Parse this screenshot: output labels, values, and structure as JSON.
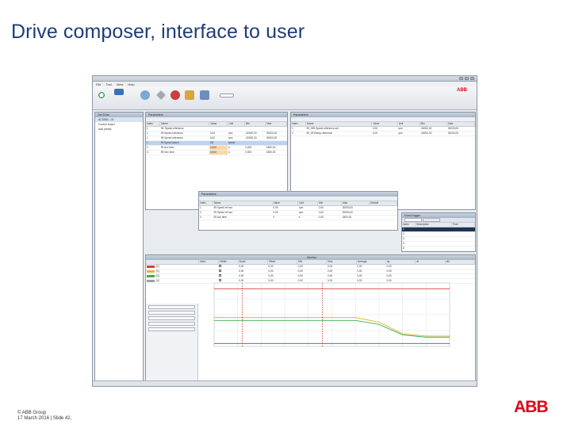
{
  "slide": {
    "title": "Drive composer, interface to user",
    "footer_line1": "© ABB Group",
    "footer_line2": "17 March 2016 | Slide 42,",
    "logo": "ABB"
  },
  "colors": {
    "brand_red": "#e10019",
    "title_blue": "#1f3c78",
    "selection_blue": "#bcd3ee",
    "highlight_orange": "#fbd7a1"
  },
  "app": {
    "menu": [
      "File",
      "Tool",
      "View",
      "Help"
    ],
    "ribbon_logo": "ABB",
    "ribbon_buttons": [
      "",
      "",
      "",
      "",
      "",
      ""
    ]
  },
  "drive_list": {
    "header": "Get Drive",
    "items": [
      "ACS880 - 02",
      "Control board",
      "Add preset"
    ]
  },
  "params_left": {
    "header": "Parameters",
    "columns": [
      "Index",
      "Name",
      "Value",
      "Unit",
      "Min",
      "Max"
    ],
    "rows": [
      {
        "index": "1",
        "name": "99. Speed reference",
        "value": "",
        "unit": "",
        "min": "",
        "max": "",
        "sel": false
      },
      {
        "index": "1",
        "name": "99 Speed reference",
        "value": "0.00",
        "unit": "rpm",
        "min": "-30000,00",
        "max": "30000,00",
        "sel": false
      },
      {
        "index": "1",
        "name": "99 Speed reference",
        "value": "0.00",
        "unit": "rpm",
        "min": "-30000,00",
        "max": "30000,00",
        "sel": false
      },
      {
        "index": "1",
        "name": "99 Speed select",
        "value": "Off",
        "unit": "select",
        "min": "",
        "max": "",
        "sel": true
      },
      {
        "index": "2",
        "name": "99 Acc time",
        "value": "2,000",
        "unit": "s",
        "min": "0,000",
        "max": "1800,00",
        "sel": false
      },
      {
        "index": "3",
        "name": "99 Dec time",
        "value": "2,000",
        "unit": "s",
        "min": "0,000",
        "max": "1800,00",
        "sel": false
      }
    ]
  },
  "params_right": {
    "header": "Parameters",
    "columns": [
      "Index",
      "Name",
      "Value",
      "Unit",
      "Min",
      "Max"
    ],
    "rows": [
      {
        "index": "1",
        "name": "99_999 Speed reference act",
        "value": "0.00",
        "unit": "rpm",
        "min": "-30000,00",
        "max": "30000,00"
      },
      {
        "index": "2",
        "name": "99_99 Ramp reference",
        "value": "0.00",
        "unit": "rpm",
        "min": "-30000,00",
        "max": "30000,00"
      }
    ]
  },
  "params_mid": {
    "header": "Parameters",
    "columns": [
      "Index",
      "Name",
      "Value",
      "Unit",
      "Min",
      "Max",
      "Default"
    ],
    "rows": [
      {
        "index": "1",
        "name": "99 Speed ref act",
        "value": "0.00",
        "unit": "rpm",
        "min": "0,00",
        "max": "30000,00",
        "def": ""
      },
      {
        "index": "2",
        "name": "99 Speed ref act",
        "value": "0.00",
        "unit": "rpm",
        "min": "0,00",
        "max": "30000,00",
        "def": ""
      },
      {
        "index": "3",
        "name": "99 Acc time",
        "value": "0",
        "unit": "s",
        "min": "0,00",
        "max": "1800,00",
        "def": ""
      }
    ]
  },
  "fault_logger": {
    "header": "Event logger",
    "tabs": [
      "",
      ""
    ],
    "columns": [
      "Index",
      "Description",
      "Time"
    ],
    "rows": [
      {
        "index": "1",
        "desc": "",
        "time": "",
        "dark": true
      },
      {
        "index": "2",
        "desc": "",
        "time": "",
        "dark": false
      },
      {
        "index": "3",
        "desc": "",
        "time": "",
        "dark": false
      },
      {
        "index": "4",
        "desc": "",
        "time": "",
        "dark": false
      },
      {
        "index": "5",
        "desc": "",
        "time": "",
        "dark": false
      }
    ]
  },
  "monitor": {
    "header": "Monitor",
    "columns": [
      "",
      "Index",
      "Visible",
      "Scale",
      "Offset",
      "Min",
      "Max",
      "Average",
      "dy",
      "dt",
      "dt2"
    ],
    "rows": [
      {
        "name": "[1]",
        "color": "#d23d3d",
        "vals": [
          "0,00",
          "0,00",
          "0,00",
          "0,00",
          "0,00",
          "0,00",
          "",
          ""
        ]
      },
      {
        "name": "[2]",
        "color": "#d9b830",
        "vals": [
          "0,00",
          "0,00",
          "0,00",
          "0,00",
          "0,00",
          "0,00",
          "",
          ""
        ]
      },
      {
        "name": "[3]",
        "color": "#3fae49",
        "vals": [
          "0,00",
          "0,00",
          "0,00",
          "0,00",
          "0,00",
          "0,00",
          "",
          ""
        ]
      },
      {
        "name": "[4]",
        "color": "#9aa0a6",
        "vals": [
          "0,00",
          "0,00",
          "0,00",
          "0,00",
          "0,00",
          "0,00",
          "",
          ""
        ]
      }
    ],
    "side_labels": [
      "",
      "",
      "",
      "",
      ""
    ]
  },
  "chart_data": {
    "type": "line",
    "x": [
      0,
      1,
      2,
      3,
      4,
      5,
      6,
      7,
      8,
      9,
      10
    ],
    "series": [
      {
        "values": [
          1,
          1,
          1,
          1,
          1,
          1,
          1,
          1,
          1,
          1,
          1
        ],
        "color": "#d23d3d"
      },
      {
        "values": [
          0.5,
          0.5,
          0.5,
          0.5,
          0.5,
          0.5,
          0.5,
          0.42,
          0.22,
          0.18,
          0.18
        ],
        "color": "#d9b830"
      },
      {
        "values": [
          0.45,
          0.45,
          0.45,
          0.45,
          0.45,
          0.45,
          0.45,
          0.38,
          0.2,
          0.16,
          0.16
        ],
        "color": "#3fae49"
      },
      {
        "values": [
          0.05,
          0.05,
          0.05,
          0.05,
          0.05,
          0.05,
          0.05,
          0.05,
          0.05,
          0.05,
          0.05
        ],
        "color": "#6d7278"
      }
    ],
    "ylim": [
      0,
      1.1
    ],
    "grid": true
  }
}
